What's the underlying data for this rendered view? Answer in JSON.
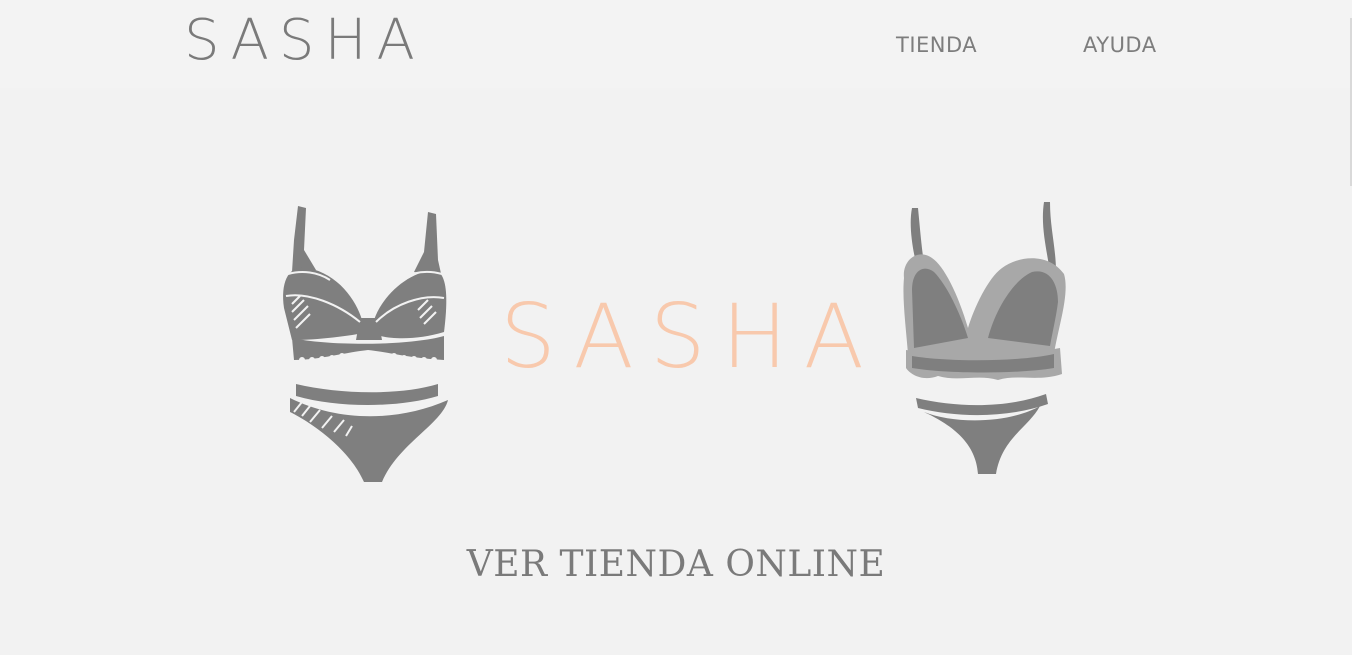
{
  "header": {
    "logo": "SASHA",
    "nav": [
      {
        "label": "TIENDA"
      },
      {
        "label": "AYUDA"
      }
    ]
  },
  "hero": {
    "title": "SASHA",
    "cta_label": "VER TIENDA ONLINE"
  },
  "colors": {
    "background": "#f2f2f2",
    "text_gray": "#7a7a7a",
    "accent_peach": "#f8c9ad",
    "illustration_gray": "#7f7f7f",
    "illustration_light_gray": "#a8a8a8"
  },
  "icons": {
    "left_illustration": "bra-and-panty-lace-illustration",
    "right_illustration": "bralette-and-thong-ruffle-illustration"
  }
}
